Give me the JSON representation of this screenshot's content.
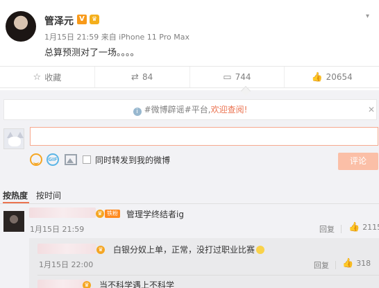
{
  "post": {
    "username": "管泽元",
    "verified_badge": "V",
    "member_icon": "crown-icon",
    "meta": "1月15日 21:59 来自 iPhone 11 Pro Max",
    "text": "总算预测对了一场。。。。",
    "menu_icon": "chevron-down-icon"
  },
  "actions": [
    {
      "icon": "star-icon",
      "label": "收藏"
    },
    {
      "icon": "repost-icon",
      "label": "84"
    },
    {
      "icon": "comment-icon",
      "label": "744"
    },
    {
      "icon": "thumbs-up-icon",
      "label": "20654"
    }
  ],
  "rumor_notice": {
    "prefix": "#微博辟谣#平台,",
    "link": "欢迎查阅!",
    "info_icon": "i"
  },
  "comment_box": {
    "input_value": "",
    "repost_label": "同时转发到我的微博",
    "submit_label": "评论"
  },
  "sort": {
    "hot": "按热度",
    "time": "按时间"
  },
  "comments": [
    {
      "badge": "铁粉",
      "text": "管理学终结者ig",
      "time": "1月15日 21:59",
      "reply": "回复",
      "likes": "2115"
    }
  ],
  "replies": [
    {
      "text": "白银分奴上单，正常，没打过职业比赛",
      "time": "1月15日 22:00",
      "reply": "回复",
      "likes": "318"
    },
    {
      "text": "当不科学遇上不科学"
    }
  ],
  "colors": {
    "accent": "#eb7350",
    "submit_bg": "#fbbfa7",
    "panel_bg": "#f2f2f5"
  }
}
